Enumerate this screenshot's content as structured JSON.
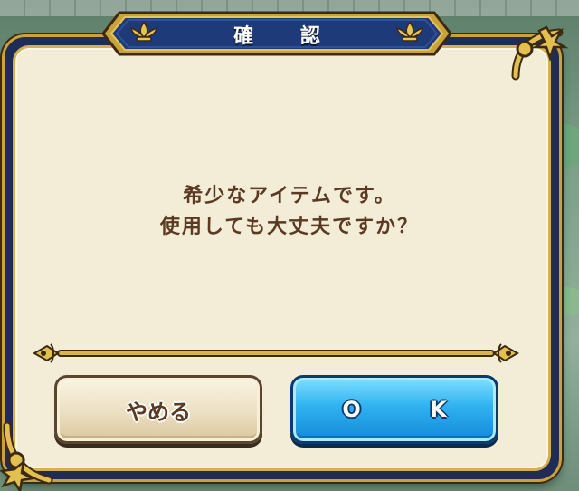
{
  "dialog": {
    "title": "確 認",
    "message_line1": "希少なアイテムです。",
    "message_line2": "使用しても大丈夫ですか？"
  },
  "buttons": {
    "cancel_label": "やめる",
    "ok_label": "O K"
  },
  "colors": {
    "frame_navy": "#1f2c58",
    "frame_gold": "#c8a23a",
    "panel_cream": "#f3ecd6",
    "text_brown": "#5a3a22",
    "ok_blue": "#2fb2f0",
    "cancel_beige": "#ece0c2"
  },
  "icons": {
    "title_ornament": "fleur-de-lis-icon",
    "corner_ornament": "scroll-ornament-icon",
    "divider": "gold-divider"
  }
}
